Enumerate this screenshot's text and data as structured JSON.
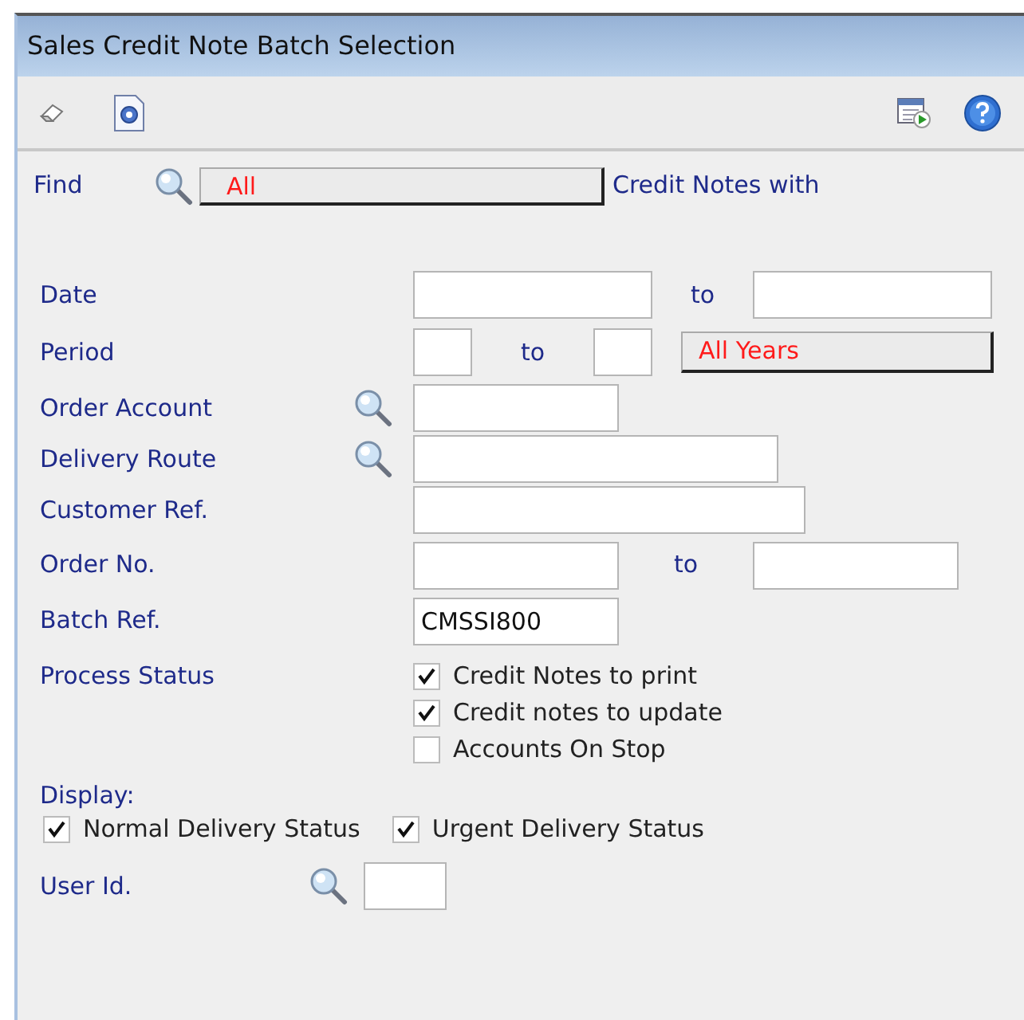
{
  "window": {
    "title": "Sales Credit Note Batch Selection"
  },
  "find": {
    "label": "Find",
    "value": "All",
    "suffix": "Credit Notes with"
  },
  "date": {
    "label": "Date",
    "to": "to"
  },
  "period": {
    "label": "Period",
    "to": "to",
    "button": "All Years"
  },
  "order_account": {
    "label": "Order Account"
  },
  "delivery_route": {
    "label": "Delivery Route"
  },
  "customer_ref": {
    "label": "Customer Ref."
  },
  "order_no": {
    "label": "Order No.",
    "to": "to"
  },
  "batch_ref": {
    "label": "Batch Ref.",
    "value": "CMSSI800"
  },
  "process_status": {
    "label": "Process Status",
    "options": [
      {
        "label": "Credit Notes to print",
        "checked": true
      },
      {
        "label": "Credit notes to update",
        "checked": true
      },
      {
        "label": "Accounts On Stop",
        "checked": false
      }
    ]
  },
  "display": {
    "label": "Display:",
    "options": [
      {
        "label": "Normal Delivery Status",
        "checked": true
      },
      {
        "label": "Urgent Delivery Status",
        "checked": true
      }
    ]
  },
  "user_id": {
    "label": "User Id."
  }
}
